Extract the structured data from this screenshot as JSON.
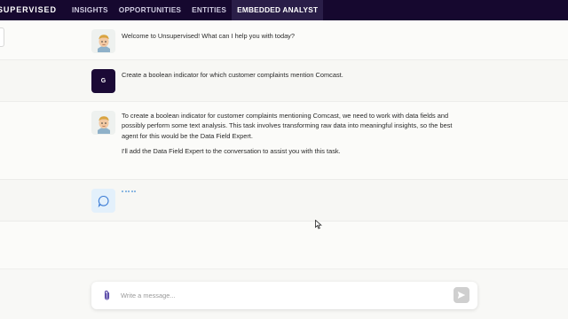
{
  "nav": {
    "brand": "SUPERVISED",
    "tabs": [
      {
        "label": "INSIGHTS"
      },
      {
        "label": "OPPORTUNITIES"
      },
      {
        "label": "ENTITIES"
      },
      {
        "label": "EMBEDDED ANALYST"
      }
    ],
    "active_tab": "EMBEDDED ANALYST",
    "background": "#16082f"
  },
  "messages": [
    {
      "sender": "assistant",
      "avatar": "memoji-icon",
      "text": "Welcome to Unsupervised! What can I help you with today?"
    },
    {
      "sender": "user",
      "avatar_letter": "G",
      "text": "Create a boolean indicator for which customer complaints mention Comcast."
    },
    {
      "sender": "assistant",
      "avatar": "memoji-icon",
      "paragraphs": [
        "To create a boolean indicator for customer complaints mentioning Comcast, we need to work with data fields and possibly perform some text analysis. This task involves transforming raw data into meaningful insights, so the best agent for this would be the Data Field Expert.",
        "I'll add the Data Field Expert to the conversation to assist you with this task."
      ]
    },
    {
      "sender": "agent",
      "avatar": "chat-bubble-icon",
      "status": "typing"
    }
  ],
  "composer": {
    "placeholder": "Write a message...",
    "value": "",
    "attach_icon": "paperclip-icon",
    "send_icon": "send-icon"
  },
  "colors": {
    "accent": "#6aa3dc",
    "user_avatar": "#1b0a36",
    "attach": "#5a4aa8"
  }
}
